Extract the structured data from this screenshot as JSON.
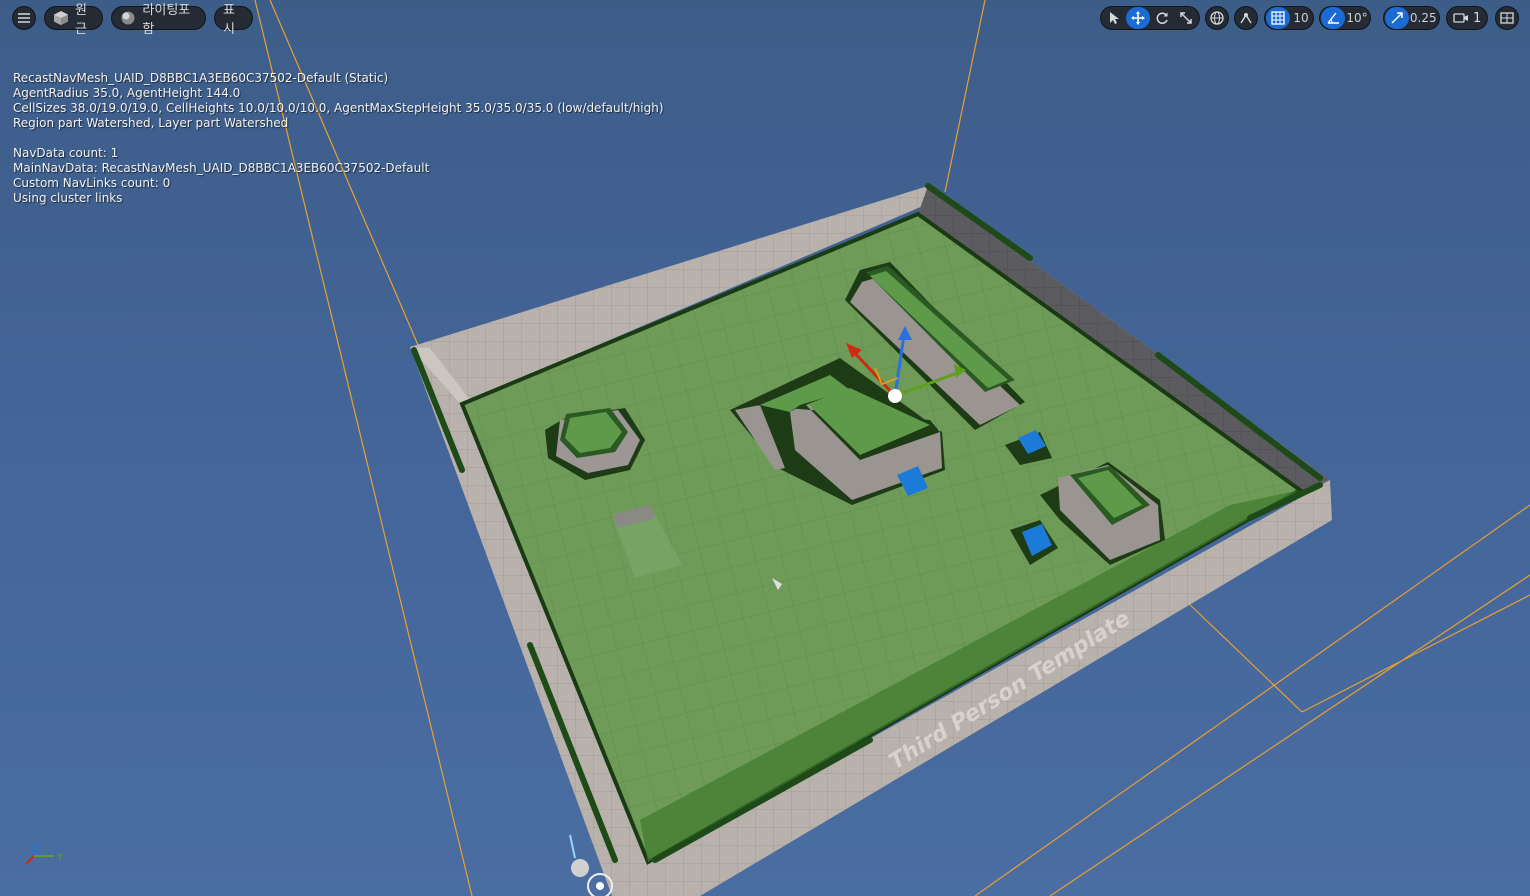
{
  "toolbar_left": {
    "perspective_label": "원근",
    "lighting_label": "라이팅포함",
    "show_label": "표시"
  },
  "toolbar_right": {
    "grid_snap_value": "10",
    "rotation_snap_value": "10°",
    "scale_snap_value": "0.25",
    "camera_speed_value": "1"
  },
  "stats": {
    "lines": [
      "RecastNavMesh_UAID_D8BBC1A3EB60C37502-Default (Static)",
      "AgentRadius 35.0, AgentHeight 144.0",
      "CellSizes 38.0/19.0/19.0, CellHeights 10.0/10.0/10.0, AgentMaxStepHeight 35.0/35.0/35.0 (low/default/high)",
      "Region part Watershed, Layer part Watershed",
      "",
      "NavData count: 1",
      "MainNavData: RecastNavMesh_UAID_D8BBC1A3EB60C37502-Default",
      "Custom NavLinks count: 0",
      "Using cluster links"
    ]
  },
  "scene": {
    "wall_text": "Third Person Template"
  },
  "axis": {
    "z_label": "Z",
    "y_label": "Y"
  },
  "colors": {
    "accent": "#1c6bd4",
    "navmesh": "#5f9a4a",
    "selection_line": "#e8a030"
  }
}
